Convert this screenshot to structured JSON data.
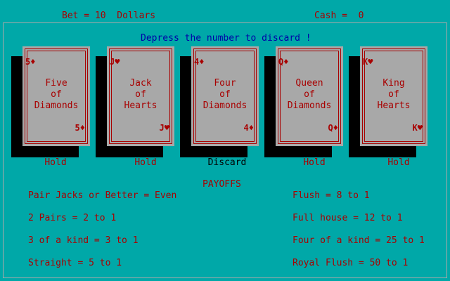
{
  "header": {
    "bet_text": "Bet = 10  Dollars",
    "cash_text": "Cash =  0"
  },
  "instruction": "Depress the number to discard !",
  "cards": [
    {
      "corner": "5♦",
      "line1": "Five",
      "line2": "of",
      "line3": "Diamonds",
      "action": "Hold"
    },
    {
      "corner": "J♥",
      "line1": "Jack",
      "line2": "of",
      "line3": "Hearts",
      "action": "Hold"
    },
    {
      "corner": "4♦",
      "line1": "Four",
      "line2": "of",
      "line3": "Diamonds",
      "action": "Discard"
    },
    {
      "corner": "Q♦",
      "line1": "Queen",
      "line2": "of",
      "line3": "Diamonds",
      "action": "Hold"
    },
    {
      "corner": "K♥",
      "line1": "King",
      "line2": "of",
      "line3": "Hearts",
      "action": "Hold"
    }
  ],
  "payoffs": {
    "title": "PAYOFFS",
    "left": [
      "Pair Jacks or Better = Even",
      "2 Pairs = 2 to 1",
      "3 of a kind = 3 to 1",
      "Straight = 5 to 1"
    ],
    "right": [
      "Flush = 8 to 1",
      "Full house = 12 to 1",
      "Four of a kind = 25 to 1",
      "Royal Flush = 50 to 1"
    ]
  },
  "colors": {
    "background": "#00a8a8",
    "text_red": "#a80000",
    "text_blue": "#0000a8",
    "card_face": "#a8a8a8",
    "shadow": "#000000"
  }
}
